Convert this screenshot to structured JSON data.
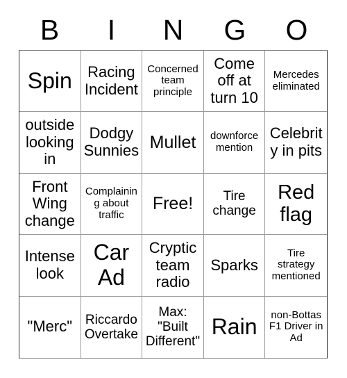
{
  "card": {
    "title": "BINGO",
    "header_letters": [
      "B",
      "I",
      "N",
      "G",
      "O"
    ],
    "grid_size": "5x5",
    "free_space_label": "Free!",
    "background_color": "#ffffff",
    "text_color": "#000000",
    "border_color": "#9a9a9a"
  },
  "rows": [
    {
      "cells": [
        {
          "text": "Spin",
          "size": "size-xl"
        },
        {
          "text": "Racing Incident",
          "size": "size-md"
        },
        {
          "text": "Concerned team principle",
          "size": "size-xs"
        },
        {
          "text": "Come off at turn 10",
          "size": "size-md"
        },
        {
          "text": "Mercedes eliminated",
          "size": "size-xs"
        }
      ]
    },
    {
      "cells": [
        {
          "text": "outside looking in",
          "size": "size-md"
        },
        {
          "text": "Dodgy Sunnies",
          "size": "size-md"
        },
        {
          "text": "Mullet",
          "size": "size-ml"
        },
        {
          "text": "downforce mention",
          "size": "size-xs"
        },
        {
          "text": "Celebrity in pits",
          "size": "size-md"
        }
      ]
    },
    {
      "cells": [
        {
          "text": "Front Wing change",
          "size": "size-md"
        },
        {
          "text": "Complaining about traffic",
          "size": "size-xs"
        },
        {
          "text": "Free!",
          "size": "size-ml"
        },
        {
          "text": "Tire change",
          "size": "size-sm"
        },
        {
          "text": "Red flag",
          "size": "size-lg"
        }
      ]
    },
    {
      "cells": [
        {
          "text": "Intense look",
          "size": "size-md"
        },
        {
          "text": "Car Ad",
          "size": "size-xl"
        },
        {
          "text": "Cryptic team radio",
          "size": "size-md"
        },
        {
          "text": "Sparks",
          "size": "size-md"
        },
        {
          "text": "Tire strategy mentioned",
          "size": "size-xs"
        }
      ]
    },
    {
      "cells": [
        {
          "text": "\"Merc\"",
          "size": "size-md"
        },
        {
          "text": "Riccardo Overtake",
          "size": "size-sm"
        },
        {
          "text": "Max: \"Built Different\"",
          "size": "size-sm"
        },
        {
          "text": "Rain",
          "size": "size-xl"
        },
        {
          "text": "non-Bottas F1 Driver in Ad",
          "size": "size-xs"
        }
      ]
    }
  ]
}
